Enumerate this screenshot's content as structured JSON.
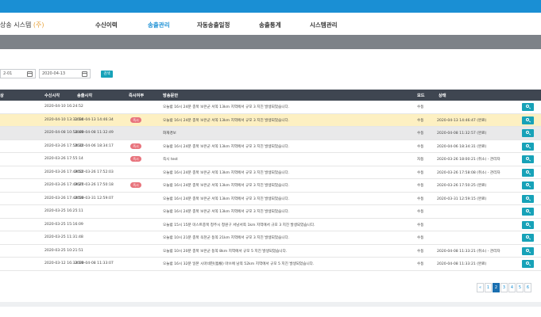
{
  "header": {
    "app_title": "상송 시스템",
    "app_title_mark": "(주)"
  },
  "nav": {
    "items": [
      {
        "label": "수신이력",
        "active": false
      },
      {
        "label": "송출관리",
        "active": true
      },
      {
        "label": "자동송출일정",
        "active": false
      },
      {
        "label": "송출통계",
        "active": false
      },
      {
        "label": "시스템관리",
        "active": false
      }
    ]
  },
  "filter": {
    "date_from": "2-01",
    "date_to": "2020-04-13",
    "search_label": "검색"
  },
  "table": {
    "columns": [
      "상",
      "수신시각",
      "송출시각",
      "즉시여부",
      "방송문안",
      "모드",
      "상태"
    ],
    "rows": [
      {
        "recv": "2020-04-10 16:24:52",
        "sent": "",
        "immediate": "",
        "message": "오늘밤 16시 24분 충북 보은군 서쪽 13km 지역에서 규모 3 지진 발생되었습니다.",
        "mode": "수동",
        "status": "",
        "style": ""
      },
      {
        "recv": "2020-04-10 13:31:14",
        "sent": "2020-04-13 14:46:34",
        "immediate": "즉시",
        "message": "오늘밤 16시 24분 충북 보은군 서쪽 13km 지역에서 규모 3 지진 발생되었습니다.",
        "mode": "수동",
        "status": "2020-04-13 14:46:47 (완료)",
        "style": "highlight"
      },
      {
        "recv": "2020-04-08 10:54:49",
        "sent": "2020-04-08 11:32:49",
        "immediate": "",
        "message": "화재경보",
        "mode": "수동",
        "status": "2020-04-08 11:32:57 (완료)",
        "style": "gray"
      },
      {
        "recv": "2020-03-26 17:58:32",
        "sent": "2020-04-06 18:34:17",
        "immediate": "즉시",
        "message": "오늘밤 16시 24분 충북 보은군 서쪽 13km 지역에서 규모 3 지진 발생되었습니다.",
        "mode": "수동",
        "status": "2020-04-06 18:34:31 (완료)",
        "style": ""
      },
      {
        "recv": "2020-03-26 17:55:14",
        "sent": "",
        "immediate": "즉시",
        "message": "즉시 test",
        "mode": "자동",
        "status": "2020-03-26 18:00:21 (취소) - 관리자",
        "style": ""
      },
      {
        "recv": "2020-03-26 17:49:52",
        "sent": "2020-03-26 17:52:03",
        "immediate": "",
        "message": "오늘밤 16시 24분 충북 보은군 서쪽 13km 지역에서 규모 3 지진 발생되었습니다.",
        "mode": "수동",
        "status": "2020-03-26 17:58:08 (취소) - 관리자",
        "style": ""
      },
      {
        "recv": "2020-03-26 17:49:27",
        "sent": "2020-03-26 17:50:18",
        "immediate": "즉시",
        "message": "오늘밤 16시 24분 충북 보은군 서쪽 13km 지역에서 규모 3 지진 발생되었습니다.",
        "mode": "수동",
        "status": "2020-03-26 17:50:25 (완료)",
        "style": ""
      },
      {
        "recv": "2020-03-26 17:48:59",
        "sent": "2020-03-31 12:59:07",
        "immediate": "",
        "message": "오늘밤 16시 24분 충북 보은군 서쪽 13km 지역에서 규모 3 지진 발생되었습니다.",
        "mode": "수동",
        "status": "2020-03-31 12:59:15 (완료)",
        "style": ""
      },
      {
        "recv": "2020-03-25 16:25:11",
        "sent": "",
        "immediate": "",
        "message": "오늘밤 16시 24분 충북 보은군 서쪽 13km 지역에서 규모 3 지진 발생되었습니다.",
        "mode": "수동",
        "status": "",
        "style": ""
      },
      {
        "recv": "2020-03-25 15:16:09",
        "sent": "",
        "immediate": "",
        "message": "오늘밤 15시 15분 미스트충북 청주시 청원구 서남서쪽 1km 지역에서 규모 3 지진 발생되었습니다.",
        "mode": "수동",
        "status": "",
        "style": ""
      },
      {
        "recv": "2020-03-25 11:31:48",
        "sent": "",
        "immediate": "",
        "message": "오늘밤 10시 21분 충북 옥천군 동쪽 21km 지역에서 규모 3 지진 발생되었습니다.",
        "mode": "수동",
        "status": "",
        "style": ""
      },
      {
        "recv": "2020-03-25 10:21:51",
        "sent": "",
        "immediate": "",
        "message": "오늘밤 10시 20분 충북 보은군 동쪽 8km 지역에서 규모 5 지진 발생되었습니다.",
        "mode": "수동",
        "status": "2020-04-08 11:33:21 (취소) - 관리자",
        "style": ""
      },
      {
        "recv": "2020-03-12 16:33:19",
        "sent": "2020-04-08 11:33:07",
        "immediate": "",
        "message": "오늘밤 16시 32분 일본 시마네현(島根) 마쓰에 남쪽 52km 지역에서 규모 5 지진 발생되었습니다.",
        "mode": "수동",
        "status": "2020-04-08 11:33:21 (완료)",
        "style": ""
      }
    ]
  },
  "pagination": {
    "prev": "«",
    "pages": [
      "1",
      "2",
      "3",
      "4",
      "5",
      "6"
    ],
    "active_page": "2"
  }
}
